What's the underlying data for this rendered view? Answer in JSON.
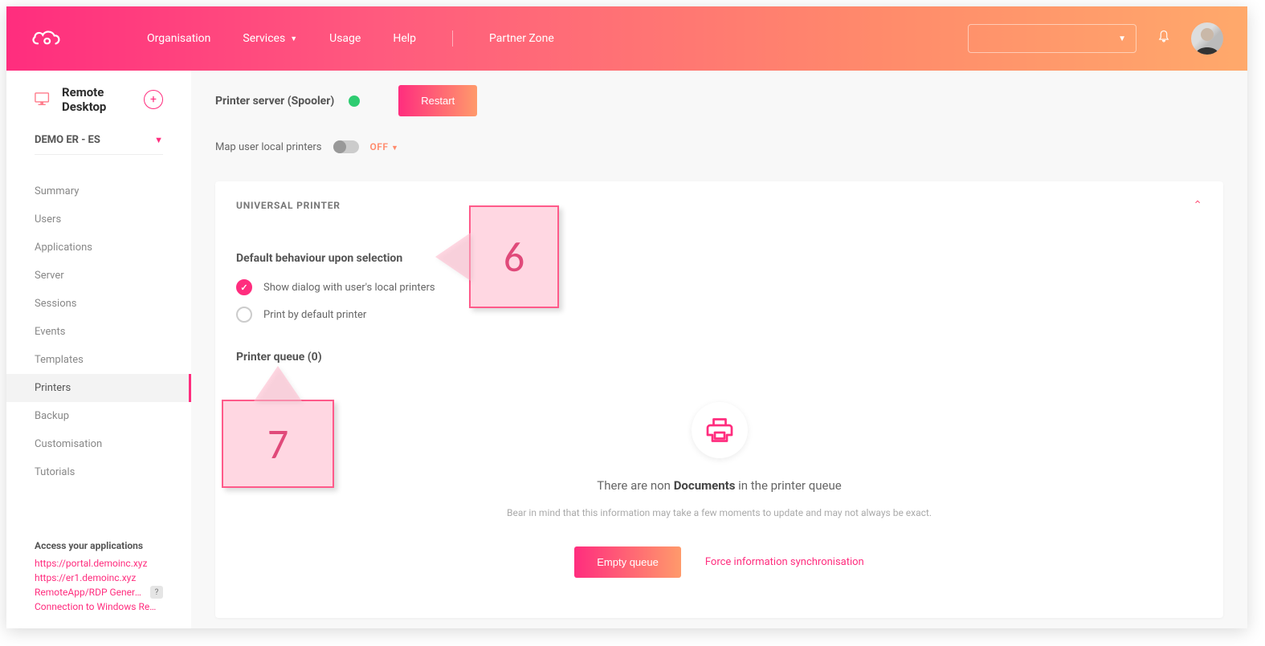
{
  "header": {
    "nav": {
      "organisation": "Organisation",
      "services": "Services",
      "usage": "Usage",
      "help": "Help",
      "partner_zone": "Partner Zone"
    }
  },
  "sidebar": {
    "title": "Remote Desktop",
    "dropdown": "DEMO ER - ES",
    "items": {
      "summary": "Summary",
      "users": "Users",
      "applications": "Applications",
      "server": "Server",
      "sessions": "Sessions",
      "events": "Events",
      "templates": "Templates",
      "printers": "Printers",
      "backup": "Backup",
      "customisation": "Customisation",
      "tutorials": "Tutorials"
    },
    "access": {
      "title": "Access your applications",
      "link1": "https://portal.demoinc.xyz",
      "link2": "https://er1.demoinc.xyz",
      "link3": "RemoteApp/RDP Generator",
      "link4": "Connection to Windows Rem..."
    }
  },
  "main": {
    "spooler_label": "Printer server (Spooler)",
    "restart": "Restart",
    "map_label": "Map user local printers",
    "map_state": "OFF",
    "panel_title": "UNIVERSAL PRINTER",
    "behaviour_title": "Default behaviour upon selection",
    "radio1": "Show dialog with user's local printers",
    "radio2": "Print by default printer",
    "queue_title": "Printer queue (0)",
    "queue_msg_pre": "There are non ",
    "queue_msg_bold": "Documents",
    "queue_msg_post": " in the printer queue",
    "queue_note": "Bear in mind that this information may take a few moments to update and may not always be exact.",
    "empty_btn": "Empty queue",
    "force_link": "Force information synchronisation"
  },
  "annotations": {
    "a6": "6",
    "a7": "7"
  }
}
